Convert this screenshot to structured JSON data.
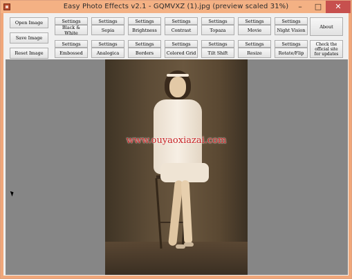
{
  "window": {
    "title": "Easy Photo Effects v2.1 - GQMVXZ (1).jpg (preview scaled 31%)",
    "controls": {
      "minimize": "–",
      "maximize": "□",
      "close": "✕"
    }
  },
  "left_buttons": [
    "Open Image",
    "Save Image",
    "Reset Image"
  ],
  "effects_row1": [
    {
      "settings": "Settings",
      "label": "Black & White"
    },
    {
      "settings": "Settings",
      "label": "Sepia"
    },
    {
      "settings": "Settings",
      "label": "Brightness"
    },
    {
      "settings": "Settings",
      "label": "Contrast"
    },
    {
      "settings": "Settings",
      "label": "Topaza"
    },
    {
      "settings": "Settings",
      "label": "Movie"
    },
    {
      "settings": "Settings",
      "label": "Night Vision"
    }
  ],
  "effects_row2": [
    {
      "settings": "Settings",
      "label": "Embossed"
    },
    {
      "settings": "Settings",
      "label": "Analogica"
    },
    {
      "settings": "Settings",
      "label": "Borders"
    },
    {
      "settings": "Settings",
      "label": "Colored Grid"
    },
    {
      "settings": "Settings",
      "label": "Tilt Shift"
    },
    {
      "settings": "Settings",
      "label": "Resize"
    },
    {
      "settings": "Settings",
      "label": "Rotate/Flip"
    }
  ],
  "about_button": "About",
  "updates_button": "Check the official site for updates",
  "preview": {
    "watermark": "www.ouyaoxiazai.com"
  },
  "icons": {
    "app": "app-icon",
    "cursor": "mouse-cursor-icon"
  }
}
